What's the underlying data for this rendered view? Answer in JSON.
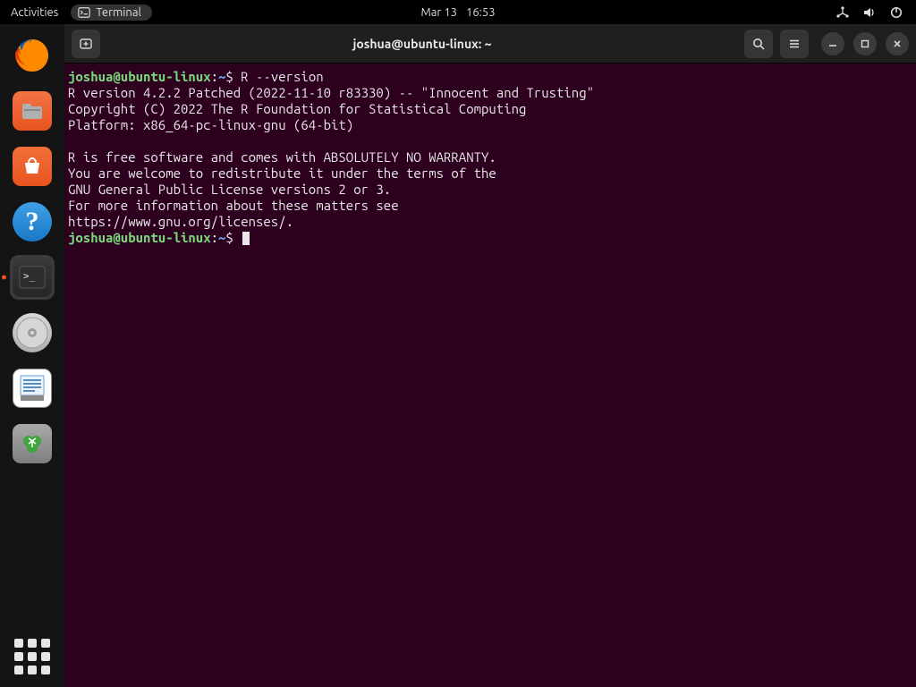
{
  "topbar": {
    "activities": "Activities",
    "app_label": "Terminal",
    "date": "Mar 13",
    "time": "16:53"
  },
  "dock": {
    "items": [
      {
        "name": "firefox",
        "title": "Firefox"
      },
      {
        "name": "files",
        "title": "Files"
      },
      {
        "name": "software-store",
        "title": "Ubuntu Software"
      },
      {
        "name": "help",
        "title": "Help"
      },
      {
        "name": "terminal",
        "title": "Terminal",
        "active": true
      },
      {
        "name": "disk",
        "title": "Disk / Media"
      },
      {
        "name": "text-editor",
        "title": "Text Editor"
      },
      {
        "name": "trash",
        "title": "Trash"
      }
    ]
  },
  "window": {
    "title": "joshua@ubuntu-linux: ~"
  },
  "terminal": {
    "prompt_user": "joshua@ubuntu-linux",
    "prompt_sep1": ":",
    "prompt_path": "~",
    "prompt_sep2": "$",
    "command": "R --version",
    "output": "R version 4.2.2 Patched (2022-11-10 r83330) -- \"Innocent and Trusting\"\nCopyright (C) 2022 The R Foundation for Statistical Computing\nPlatform: x86_64-pc-linux-gnu (64-bit)\n\nR is free software and comes with ABSOLUTELY NO WARRANTY.\nYou are welcome to redistribute it under the terms of the\nGNU General Public License versions 2 or 3.\nFor more information about these matters see\nhttps://www.gnu.org/licenses/.\n"
  }
}
